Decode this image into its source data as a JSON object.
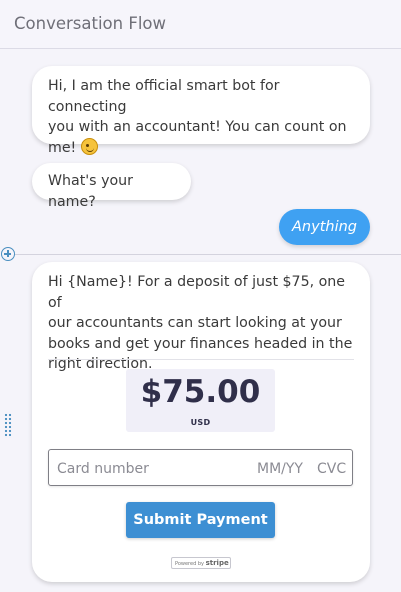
{
  "header": {
    "title": "Conversation Flow"
  },
  "messages": {
    "bot_intro": {
      "line1": "Hi, I am the official smart bot for connecting",
      "line2": "you with an accountant! You can count on",
      "line3": "me!"
    },
    "bot_question": "What's your name?",
    "user_reply": "Anything",
    "bot_offer": {
      "line1": "Hi {Name}! For a deposit of just $75, one of",
      "line2": "our accountants can start looking at your",
      "line3": "books and get your finances headed in the",
      "line4": "right direction."
    }
  },
  "payment": {
    "amount": "$75.00",
    "currency": "USD",
    "card_placeholder": "Card number",
    "expiry_placeholder": "MM/YY",
    "cvc_placeholder": "CVC",
    "submit_label": "Submit Payment",
    "powered_by": "Powered by",
    "powered_brand": "stripe"
  },
  "icons": {
    "emoji": "winking-face-icon",
    "add": "add-circle-icon",
    "drag": "drag-handle-icon"
  },
  "colors": {
    "accent": "#3fa1f2",
    "submit": "#3d8fd3",
    "background": "#f5f4fa"
  }
}
